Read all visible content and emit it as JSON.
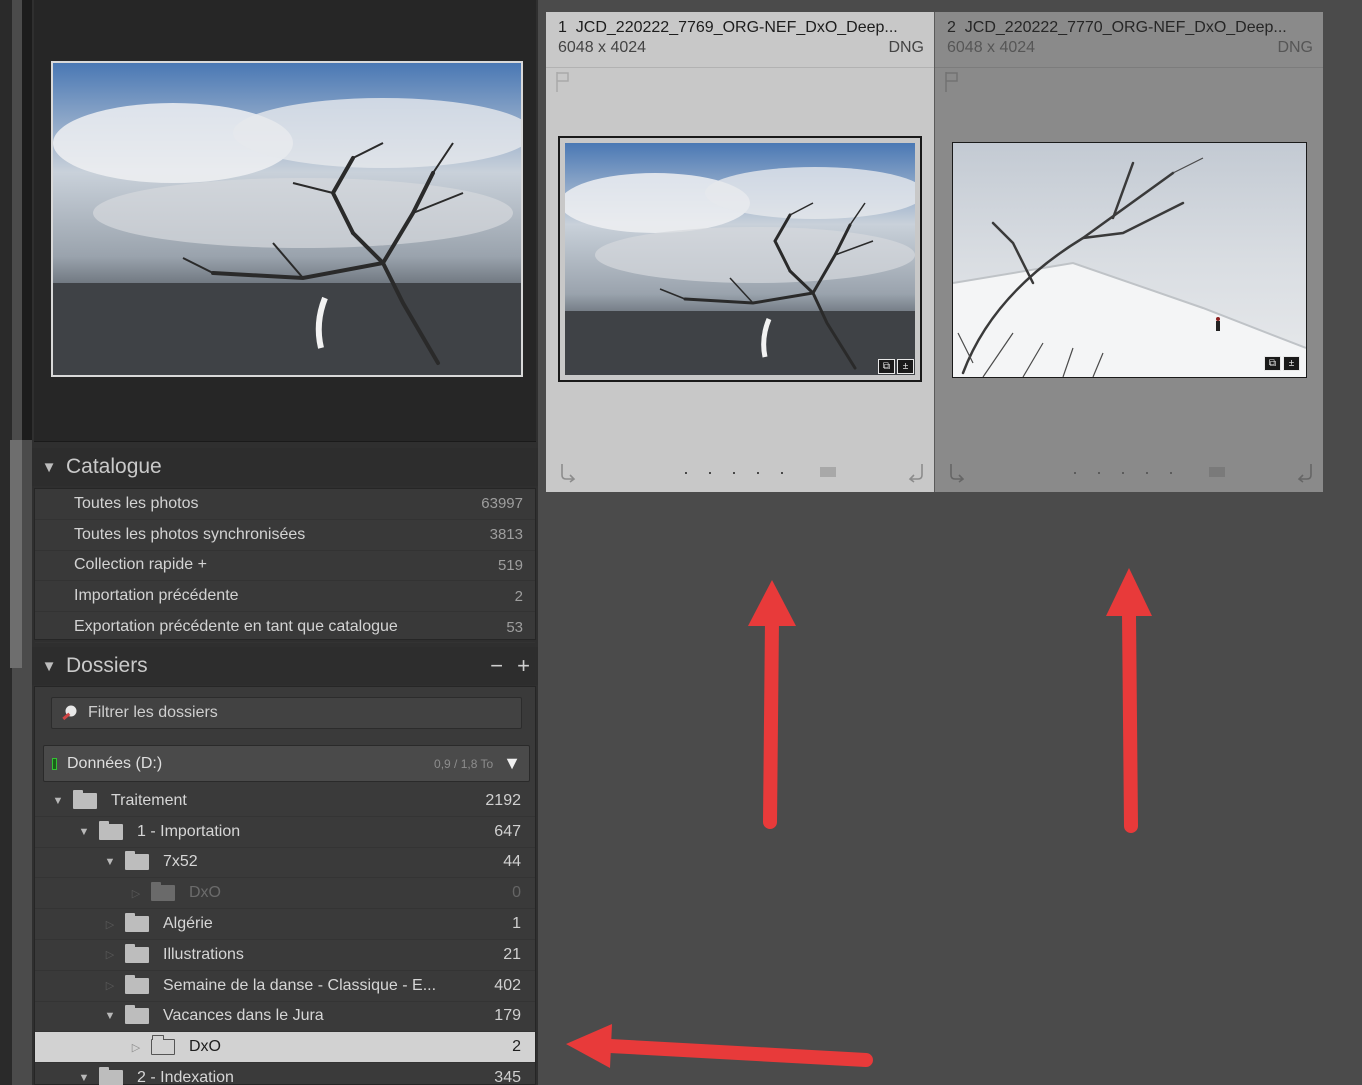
{
  "catalog": {
    "title": "Catalogue",
    "items": [
      {
        "name": "Toutes les photos",
        "count": "63997"
      },
      {
        "name": "Toutes les photos synchronisées",
        "count": "3813"
      },
      {
        "name": "Collection rapide +",
        "count": "519"
      },
      {
        "name": "Importation précédente",
        "count": "2"
      },
      {
        "name": "Exportation précédente en tant que catalogue",
        "count": "53"
      }
    ]
  },
  "folders": {
    "title": "Dossiers",
    "minus": "−",
    "plus": "+",
    "filter_placeholder": "Filtrer les dossiers",
    "volume": {
      "name": "Données (D:)",
      "size": "0,9 / 1,8 To",
      "indicator_color": "#33c233"
    },
    "tree": [
      {
        "name": "Traitement",
        "count": "2192",
        "depth": 0,
        "state": "expanded",
        "dim": false
      },
      {
        "name": "1 - Importation",
        "count": "647",
        "depth": 1,
        "state": "expanded",
        "dim": false
      },
      {
        "name": "7x52",
        "count": "44",
        "depth": 2,
        "state": "expanded",
        "dim": false
      },
      {
        "name": "DxO",
        "count": "0",
        "depth": 3,
        "state": "collapsed",
        "dim": true
      },
      {
        "name": "Algérie",
        "count": "1",
        "depth": 2,
        "state": "collapsed",
        "dim": false
      },
      {
        "name": "Illustrations",
        "count": "21",
        "depth": 2,
        "state": "collapsed",
        "dim": false
      },
      {
        "name": "Semaine de la danse - Classique - E...",
        "count": "402",
        "depth": 2,
        "state": "collapsed",
        "dim": false
      },
      {
        "name": "Vacances dans le Jura",
        "count": "179",
        "depth": 2,
        "state": "expanded",
        "dim": false
      },
      {
        "name": "DxO",
        "count": "2",
        "depth": 3,
        "state": "collapsed",
        "dim": false,
        "selected": true
      },
      {
        "name": "2 - Indexation",
        "count": "345",
        "depth": 1,
        "state": "expanded",
        "dim": false
      }
    ]
  },
  "grid": {
    "cells": [
      {
        "index": "1",
        "filename": "JCD_220222_7769_ORG-NEF_DxO_Deep...",
        "dimensions": "6048 x 4024",
        "format": "DNG",
        "selected": true
      },
      {
        "index": "2",
        "filename": "JCD_220222_7770_ORG-NEF_DxO_Deep...",
        "dimensions": "6048 x 4024",
        "format": "DNG",
        "selected": false
      }
    ],
    "rating_dots": "· · · · ·"
  },
  "annotations": {
    "arrow_color": "#e83a3a"
  }
}
